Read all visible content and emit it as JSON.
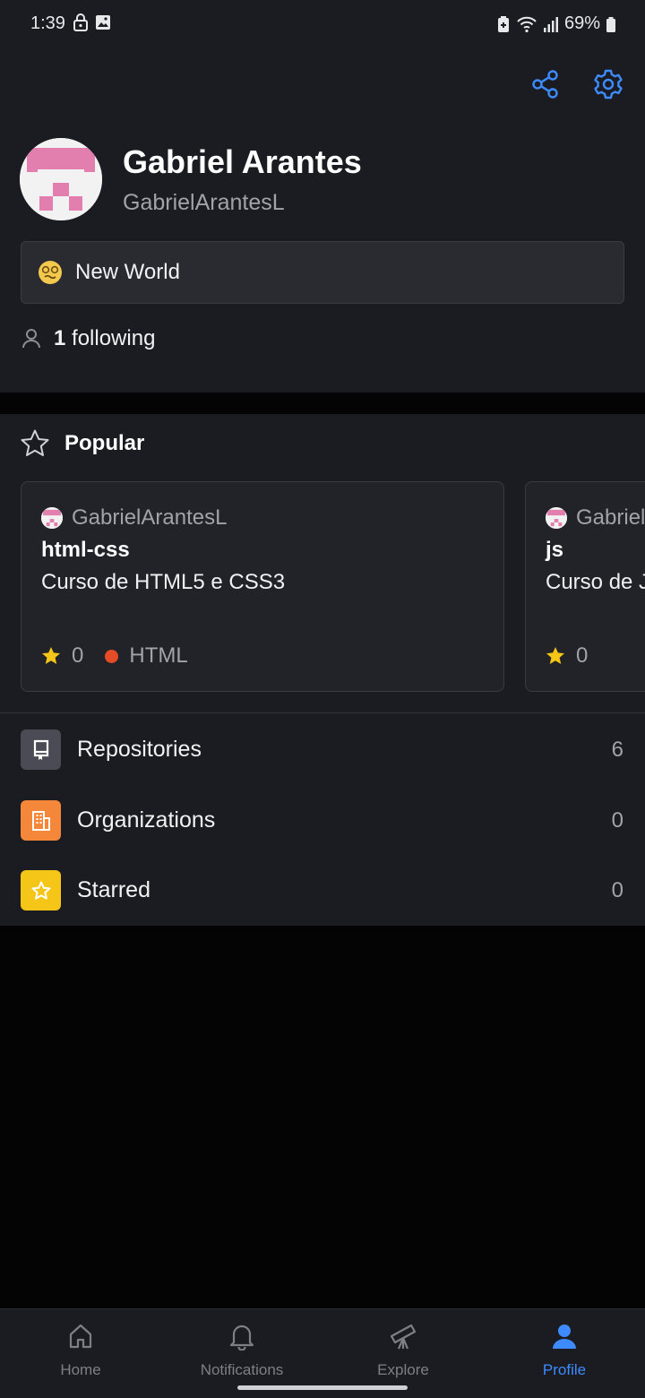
{
  "status_bar": {
    "time": "1:39",
    "battery": "69%"
  },
  "profile": {
    "name": "Gabriel Arantes",
    "login": "GabrielArantesL",
    "status": "New World",
    "following_count": "1",
    "following_label": "following"
  },
  "popular": {
    "title": "Popular",
    "repos": [
      {
        "owner": "GabrielArantesL",
        "name": "html-css",
        "description": "Curso de HTML5 e CSS3",
        "stars": "0",
        "language": "HTML",
        "language_color": "#e34c26"
      },
      {
        "owner": "GabrielArantesL",
        "name": "js",
        "description": "Curso de JavaScript",
        "stars": "0"
      }
    ]
  },
  "menu": [
    {
      "label": "Repositories",
      "count": "6",
      "icon": "repo-icon",
      "color": "#4a4b55"
    },
    {
      "label": "Organizations",
      "count": "0",
      "icon": "organization-icon",
      "color": "#f4873a"
    },
    {
      "label": "Starred",
      "count": "0",
      "icon": "star-icon",
      "color": "#f5c518"
    }
  ],
  "nav": [
    {
      "label": "Home",
      "icon": "home-icon"
    },
    {
      "label": "Notifications",
      "icon": "bell-icon"
    },
    {
      "label": "Explore",
      "icon": "telescope-icon"
    },
    {
      "label": "Profile",
      "icon": "person-icon",
      "active": true
    }
  ],
  "colors": {
    "accent": "#3d8bff",
    "background": "#1b1c21"
  }
}
